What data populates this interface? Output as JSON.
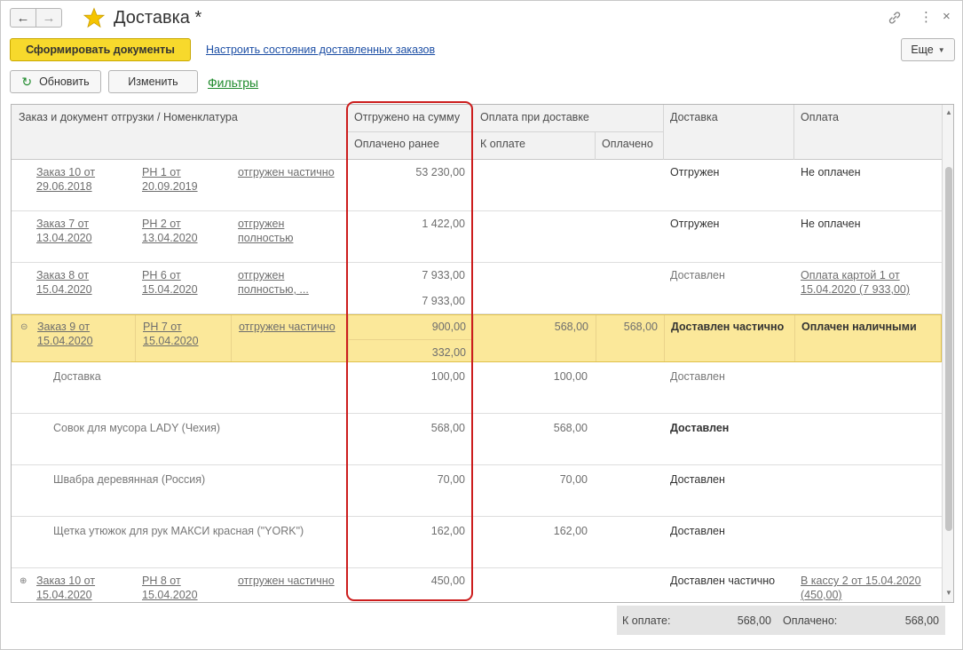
{
  "window": {
    "title": "Доставка *"
  },
  "commands": {
    "create_docs": "Сформировать документы",
    "configure_link": "Настроить состояния доставленных заказов",
    "more": "Еще",
    "refresh": "Обновить",
    "edit": "Изменить",
    "filters": "Фильтры"
  },
  "headers": {
    "order_doc": "Заказ и документ отгрузки / Номенклатура",
    "shipped_sum": "Отгружено на сумму",
    "paid_before": "Оплачено ранее",
    "cod": "Оплата при доставке",
    "to_pay": "К оплате",
    "paid": "Оплачено",
    "delivery": "Доставка",
    "payment": "Оплата"
  },
  "rows": [
    {
      "order": "Заказ 10 от 29.06.2018",
      "order_l1": "Заказ 10 от",
      "order_l2": "29.06.2018",
      "doc_l1": "РН 1 от",
      "doc_l2": "20.09.2019",
      "state_l1": "отгружен частично",
      "state_l2": "",
      "shipped": "53 230,00",
      "paid_before": "",
      "to_pay": "",
      "paid": "",
      "delivery": "Отгружен",
      "payment_l1": "Не оплачен",
      "payment_l2": ""
    },
    {
      "order_l1": "Заказ 7 от",
      "order_l2": "13.04.2020",
      "doc_l1": "РН 2 от",
      "doc_l2": "13.04.2020",
      "state_l1": "отгружен",
      "state_l2": "полностью",
      "shipped": "1 422,00",
      "paid_before": "",
      "to_pay": "",
      "paid": "",
      "delivery": "Отгружен",
      "payment_l1": "Не оплачен",
      "payment_l2": ""
    },
    {
      "order_l1": "Заказ 8 от",
      "order_l2": "15.04.2020",
      "doc_l1": "РН 6 от",
      "doc_l2": "15.04.2020",
      "state_l1": "отгружен",
      "state_l2": "полностью, ...",
      "shipped": "7 933,00",
      "paid_before": "7 933,00",
      "to_pay": "",
      "paid": "",
      "delivery": "Доставлен",
      "payment_l1": "Оплата картой 1 от",
      "payment_l2": "15.04.2020 (7 933,00)"
    },
    {
      "order_l1": "Заказ 9 от",
      "order_l2": "15.04.2020",
      "doc_l1": "РН 7 от",
      "doc_l2": "15.04.2020",
      "state_l1": "отгружен частично",
      "state_l2": "",
      "shipped": "900,00",
      "paid_before": "332,00",
      "to_pay": "568,00",
      "paid": "568,00",
      "delivery": "Доставлен частично",
      "payment_l1": "Оплачен наличными",
      "payment_l2": ""
    }
  ],
  "items": [
    {
      "name": "Доставка",
      "shipped": "100,00",
      "to_pay": "100,00",
      "delivery": "Доставлен"
    },
    {
      "name": "Совок для мусора LADY (Чехия)",
      "shipped": "568,00",
      "to_pay": "568,00",
      "delivery": "Доставлен"
    },
    {
      "name": "Швабра деревянная (Россия)",
      "shipped": "70,00",
      "to_pay": "70,00",
      "delivery": "Доставлен"
    },
    {
      "name": "Щетка утюжок для рук МАКСИ красная (\"YORK\")",
      "shipped": "162,00",
      "to_pay": "162,00",
      "delivery": "Доставлен"
    }
  ],
  "last_row": {
    "order_l1": "Заказ 10 от",
    "order_l2": "15.04.2020",
    "doc_l1": "РН 8 от",
    "doc_l2": "15.04.2020",
    "state_l1": "отгружен частично",
    "shipped": "450,00",
    "delivery": "Доставлен частично",
    "payment_l1": "В кассу 2 от 15.04.2020",
    "payment_l2": "(450,00)"
  },
  "totals": {
    "to_pay_label": "К оплате:",
    "to_pay_value": "568,00",
    "paid_label": "Оплачено:",
    "paid_value": "568,00"
  },
  "colors": {
    "primary_button": "#f7d92c",
    "selected_row": "#fbe89a",
    "highlight": "#cc1d1d",
    "link": "#1d4fa5",
    "filters_link": "#1e8a2b"
  },
  "icons": [
    "back-arrow-icon",
    "forward-arrow-icon",
    "favorite-star-icon",
    "link-icon",
    "more-vertical-icon",
    "close-icon",
    "refresh-icon",
    "collapse-icon",
    "expand-icon",
    "dropdown-icon"
  ]
}
